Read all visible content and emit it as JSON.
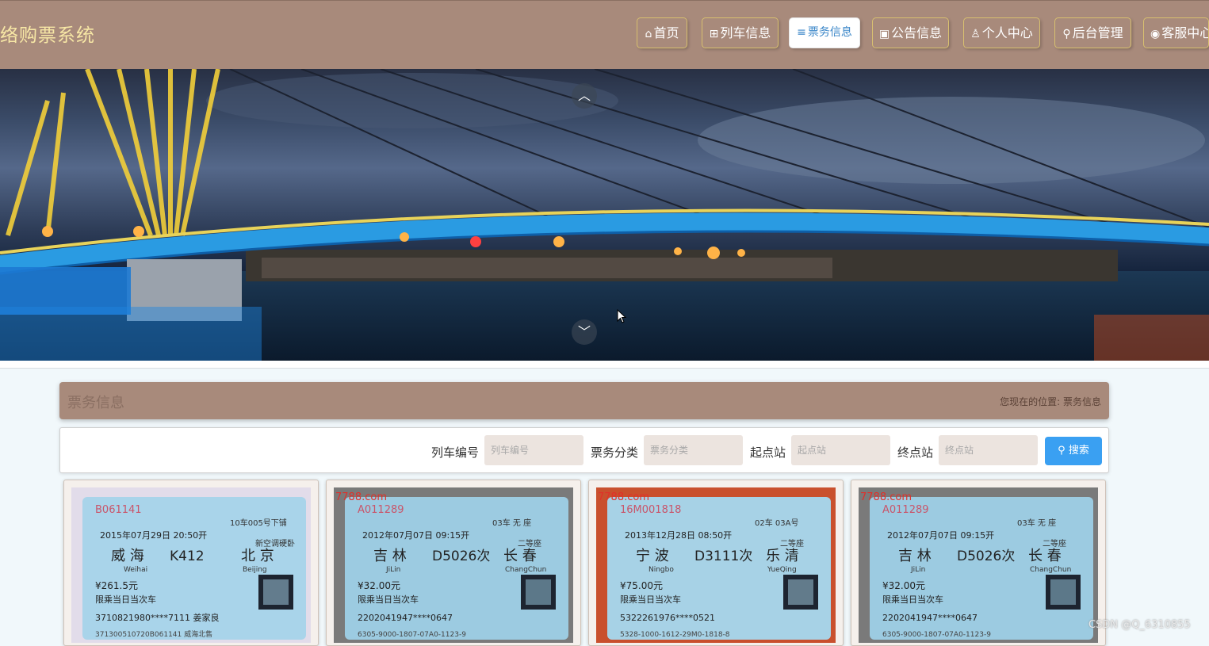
{
  "header": {
    "site_title": "络购票系统",
    "nav": [
      {
        "label": "首页",
        "icon": "home-icon",
        "glyph": "⌂"
      },
      {
        "label": "列车信息",
        "icon": "grid-icon",
        "glyph": "⊞"
      },
      {
        "label": "票务信息",
        "icon": "sliders-icon",
        "glyph": "≡",
        "active": true
      },
      {
        "label": "公告信息",
        "icon": "gift-icon",
        "glyph": "▣"
      },
      {
        "label": "个人中心",
        "icon": "user-icon",
        "glyph": "♙"
      },
      {
        "label": "后台管理",
        "icon": "link-icon",
        "glyph": "⚲"
      },
      {
        "label": "客服中心",
        "icon": "support-icon",
        "glyph": "◉"
      }
    ]
  },
  "banner": {
    "up_arrow": "︿",
    "down_arrow": "﹀"
  },
  "section": {
    "title": "票务信息",
    "breadcrumb_prefix": "您现在的位置:",
    "breadcrumb_current": "票务信息"
  },
  "search": {
    "fields": [
      {
        "label": "列车编号",
        "placeholder": "列车编号"
      },
      {
        "label": "票务分类",
        "placeholder": "票务分类"
      },
      {
        "label": "起点站",
        "placeholder": "起点站"
      },
      {
        "label": "终点站",
        "placeholder": "终点站"
      }
    ],
    "button_label": "搜索"
  },
  "cards": [
    {
      "ticket_no": "B061141",
      "from": "威 海",
      "from_py": "Weihai",
      "train": "K412",
      "to": "北 京",
      "to_py": "Beijing",
      "datetime": "2015年07月29日 20:50开",
      "seat": "10车005号下铺",
      "price": "¥261.5元",
      "type": "新空调硬卧",
      "note": "限乘当日当次车",
      "id": "3710821980****7111 姜家良",
      "serial": "371300510720B061141 威海北售",
      "site": "",
      "bg": "#a9d4ea",
      "frame": "#e2dcea"
    },
    {
      "ticket_no": "A011289",
      "from": "吉 林",
      "from_py": "JiLin",
      "train": "D5026次",
      "to": "长 春",
      "to_py": "ChangChun",
      "datetime": "2012年07月07日 09:15开",
      "seat": "03车 无 座",
      "price": "¥32.00元",
      "type": "二等座",
      "note": "限乘当日当次车",
      "id": "2202041947****0647",
      "serial": "6305-9000-1807-07A0-1123-9",
      "site": "7788.com",
      "bg": "#9ccbe1",
      "frame": "#7a7a7a"
    },
    {
      "ticket_no": "16M001818",
      "from": "宁 波",
      "from_py": "Ningbo",
      "train": "D3111次",
      "to": "乐 清",
      "to_py": "YueQing",
      "datetime": "2013年12月28日 08:50开",
      "seat": "02车 03A号",
      "price": "¥75.00元",
      "type": "二等座",
      "note": "限乘当日当次车",
      "id": "5322261976****0521",
      "serial": "5328-1000-1612-29M0-1818-8",
      "site": "7788.com",
      "bg": "#a7d2e6",
      "frame": "#c9502d"
    },
    {
      "ticket_no": "A011289",
      "from": "吉 林",
      "from_py": "JiLin",
      "train": "D5026次",
      "to": "长 春",
      "to_py": "ChangChun",
      "datetime": "2012年07月07日 09:15开",
      "seat": "03车 无 座",
      "price": "¥32.00元",
      "type": "二等座",
      "note": "限乘当日当次车",
      "id": "2202041947****0647",
      "serial": "6305-9000-1807-07A0-1123-9",
      "site": "7788.com",
      "bg": "#9ccbe1",
      "frame": "#7a7a7a"
    }
  ],
  "watermark": "CSDN @Q_6310855"
}
